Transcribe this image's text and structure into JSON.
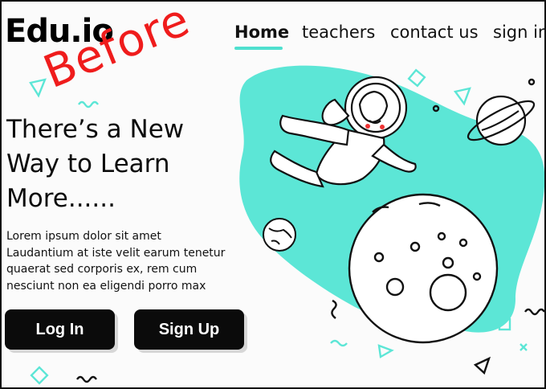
{
  "brand": {
    "logo_text": "Edu.io"
  },
  "overlay": {
    "stamp_text": "Before",
    "stamp_color": "#ef1c1c"
  },
  "nav": {
    "items": [
      {
        "label": "Home",
        "active": true
      },
      {
        "label": "teachers",
        "active": false
      },
      {
        "label": "contact us",
        "active": false
      },
      {
        "label": "sign in",
        "active": false
      }
    ]
  },
  "hero": {
    "headline": [
      "There’s a New",
      "Way to Learn",
      "More......"
    ],
    "body": [
      "Lorem ipsum dolor sit amet",
      "Laudantium at iste velit earum tenetur",
      "quaerat sed corporis ex, rem cum",
      "nesciunt non ea eligendi porro max"
    ],
    "login_label": "Log In",
    "signup_label": "Sign Up"
  },
  "illustration": {
    "name": "astronaut-space-illustration",
    "accent_color": "#5ce6d6",
    "icons": [
      "astronaut-icon",
      "moon-icon",
      "planet-ring-icon",
      "small-planet-icon",
      "triangle-icon",
      "square-icon",
      "squiggle-icon"
    ]
  },
  "colors": {
    "accent": "#4fe0cf",
    "button_bg": "#0b0b0b",
    "text": "#111111"
  }
}
